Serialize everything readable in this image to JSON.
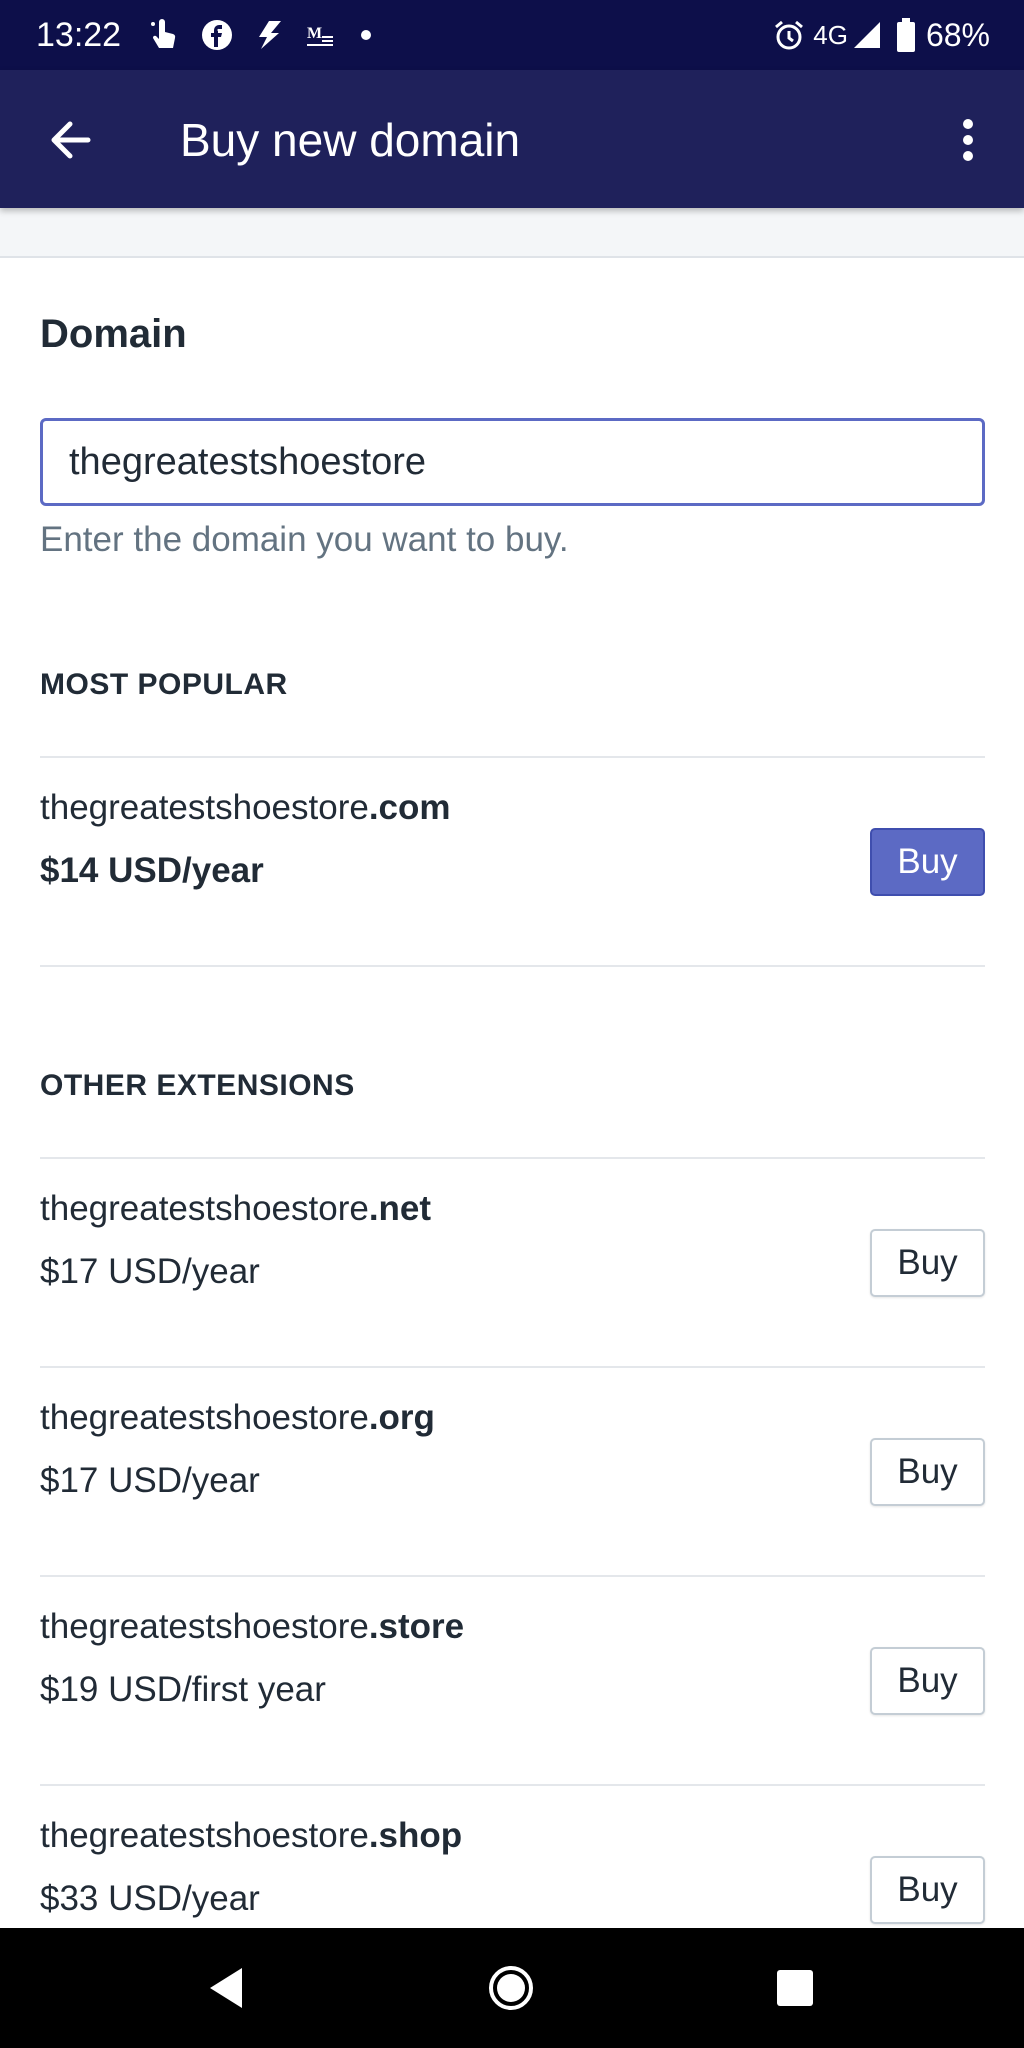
{
  "status_bar": {
    "time": "13:22",
    "network": "4G",
    "battery": "68%",
    "icons_left": [
      "touch-icon",
      "facebook-icon",
      "thunder-icon",
      "gmail-icon",
      "dot-icon"
    ],
    "icons_right": [
      "alarm-icon",
      "signal-icon",
      "battery-icon"
    ]
  },
  "app_bar": {
    "title": "Buy new domain",
    "background": "#1f215b"
  },
  "form": {
    "label": "Domain",
    "input_value": "thegreatestshoestore",
    "help_text": "Enter the domain you want to buy.",
    "accent": "#5c6ac4"
  },
  "sections": {
    "most_popular": "MOST POPULAR",
    "other_extensions": "OTHER EXTENSIONS"
  },
  "popular": {
    "name": "thegreatestshoestore",
    "ext": ".com",
    "price": "$14 USD/year",
    "button": "Buy"
  },
  "others": [
    {
      "name": "thegreatestshoestore",
      "ext": ".net",
      "price": "$17 USD/year",
      "button": "Buy"
    },
    {
      "name": "thegreatestshoestore",
      "ext": ".org",
      "price": "$17 USD/year",
      "button": "Buy"
    },
    {
      "name": "thegreatestshoestore",
      "ext": ".store",
      "price": "$19 USD/first year",
      "button": "Buy"
    },
    {
      "name": "thegreatestshoestore",
      "ext": ".shop",
      "price": "$33 USD/year",
      "button": "Buy"
    }
  ],
  "nav_bar": {
    "icons": [
      "back-triangle-icon",
      "home-circle-icon",
      "recents-square-icon"
    ]
  }
}
